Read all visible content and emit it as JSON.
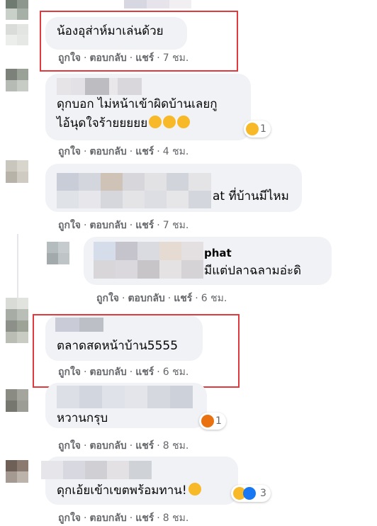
{
  "labels": {
    "like": "ถูกใจ",
    "reply": "ตอบกลับ",
    "share": "แชร์",
    "sep": "·"
  },
  "comments": [
    {
      "text": "น้องอุส่าห์มาเล่นด้วย",
      "time": "7 ชม."
    },
    {
      "line1": "ดุกบอก  ไม่หน้าเข้าผิดบ้านเลยกู",
      "line2": "ไอ้นุดใจร้ายยยยย",
      "time": "4 ชม.",
      "reaction_count": "1"
    },
    {
      "text": "at ที่บ้านมีไหม",
      "time": "7 ชม."
    },
    {
      "line1": "phat",
      "line2": "มีแต่ปลาฉลามอ่ะดิ",
      "time": "6 ชม."
    },
    {
      "text": "ตลาดสดหน้าบ้าน5555",
      "time": "6 ชม."
    },
    {
      "text": "หวานกรุบ",
      "time": "8 ชม.",
      "reaction_count": "1"
    },
    {
      "text": "ดุกเอ้ยเข้าเขตพร้อมทาน!",
      "time": "8 ชม.",
      "reaction_count": "3"
    }
  ],
  "colors": {
    "highlight": "#e0393e",
    "bubble": "#f0f2f5",
    "meta": "#65676b"
  }
}
